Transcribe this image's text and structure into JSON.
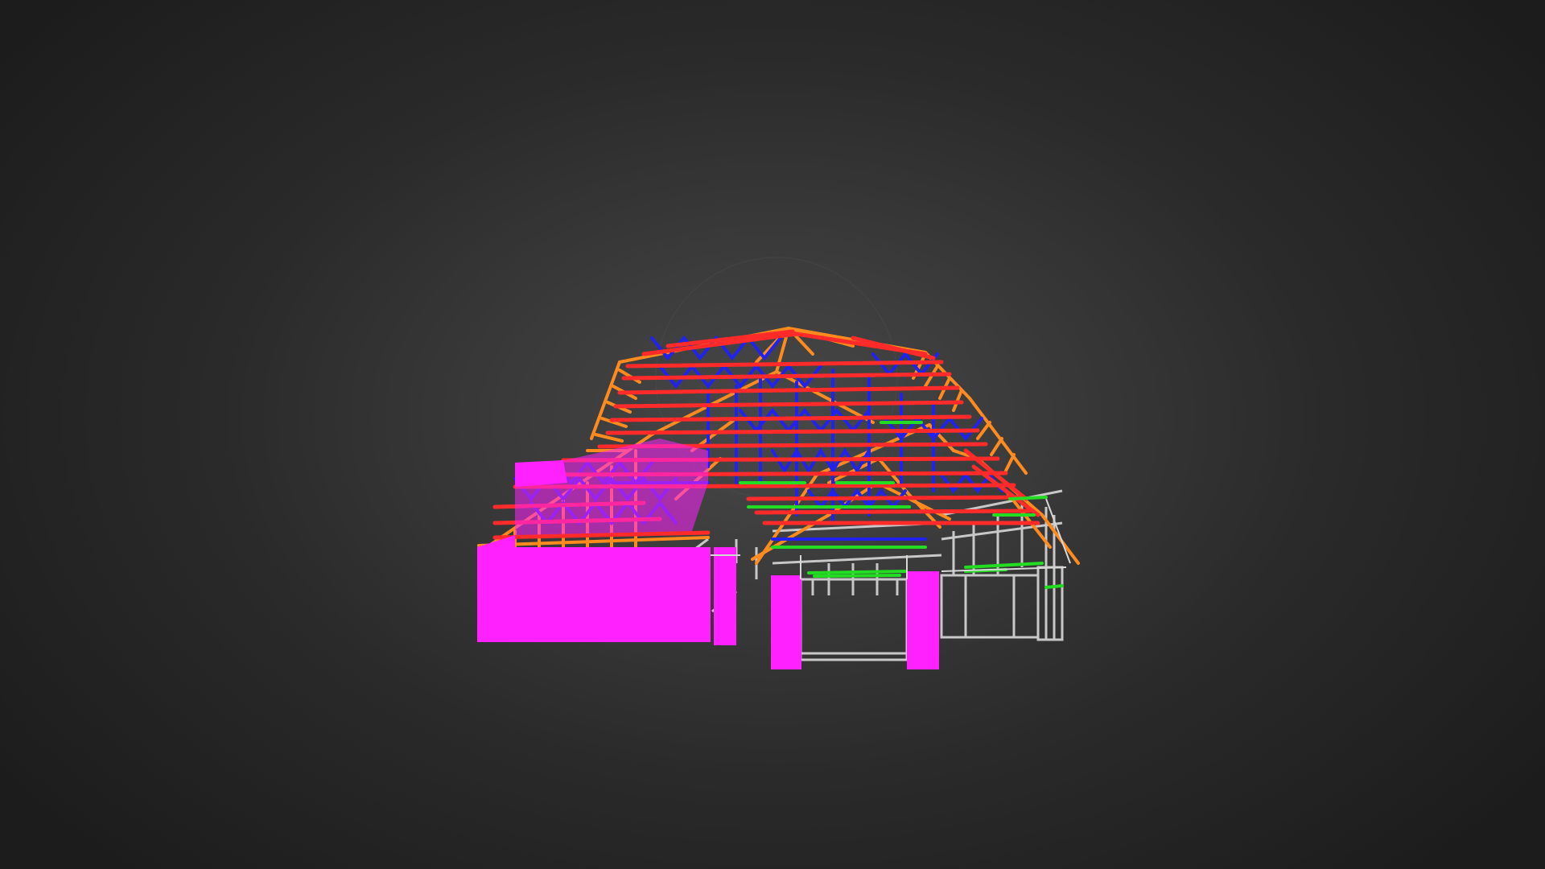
{
  "viewer": {
    "background_colors": [
      "#484848",
      "#3a3a3a",
      "#2a2a2a",
      "#1c1c1c"
    ]
  },
  "model": {
    "colors": {
      "wall_panels": "#ff22ff",
      "truss_chords": "#ff2a2a",
      "truss_webs": "#2222ee",
      "rafters_hips": "#ff8a1e",
      "bracing": "#22dd22",
      "wall_frame": "#c8c8c8"
    }
  }
}
